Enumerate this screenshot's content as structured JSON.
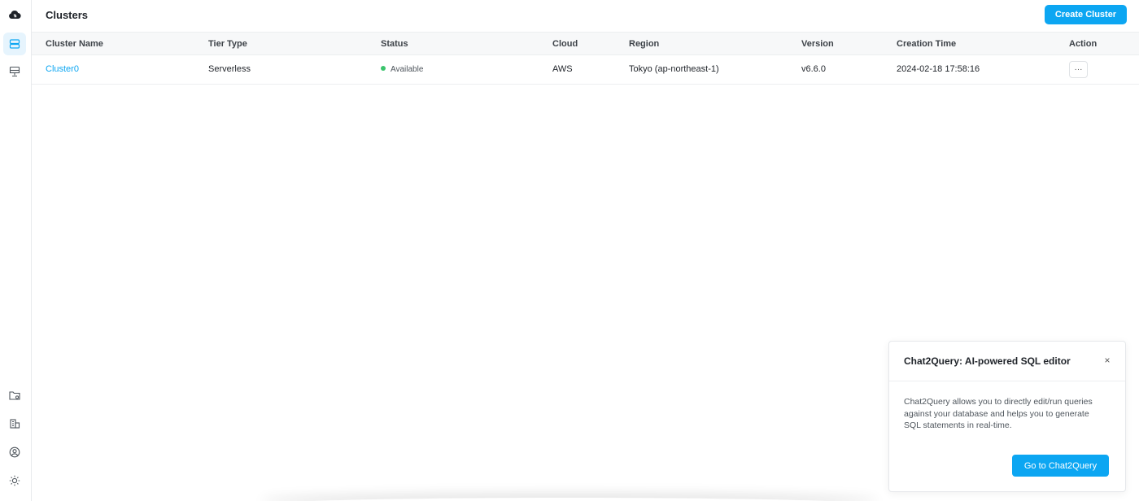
{
  "sidebar": {
    "items": [
      {
        "name": "logo-icon",
        "active": false
      },
      {
        "name": "clusters-icon",
        "active": true
      },
      {
        "name": "data-service-icon",
        "active": false
      },
      {
        "name": "folder-settings-icon",
        "active": false
      },
      {
        "name": "organization-icon",
        "active": false
      },
      {
        "name": "account-icon",
        "active": false
      },
      {
        "name": "theme-sun-icon",
        "active": false
      }
    ]
  },
  "header": {
    "title": "Clusters",
    "create_label": "Create Cluster"
  },
  "table": {
    "columns": [
      "Cluster Name",
      "Tier Type",
      "Status",
      "Cloud",
      "Region",
      "Version",
      "Creation Time",
      "Action"
    ],
    "rows": [
      {
        "cluster_name": "Cluster0",
        "tier_type": "Serverless",
        "status": "Available",
        "cloud": "AWS",
        "region": "Tokyo (ap-northeast-1)",
        "version": "v6.6.0",
        "creation_time": "2024-02-18 17:58:16",
        "action": "···"
      }
    ]
  },
  "popup": {
    "title": "Chat2Query: AI-powered SQL editor",
    "close": "×",
    "body": "Chat2Query allows you to directly edit/run queries against your database and helps you to generate SQL statements in real-time.",
    "cta_label": "Go to Chat2Query"
  },
  "colors": {
    "accent": "#0ca6f2",
    "status_available": "#3bc46c"
  }
}
